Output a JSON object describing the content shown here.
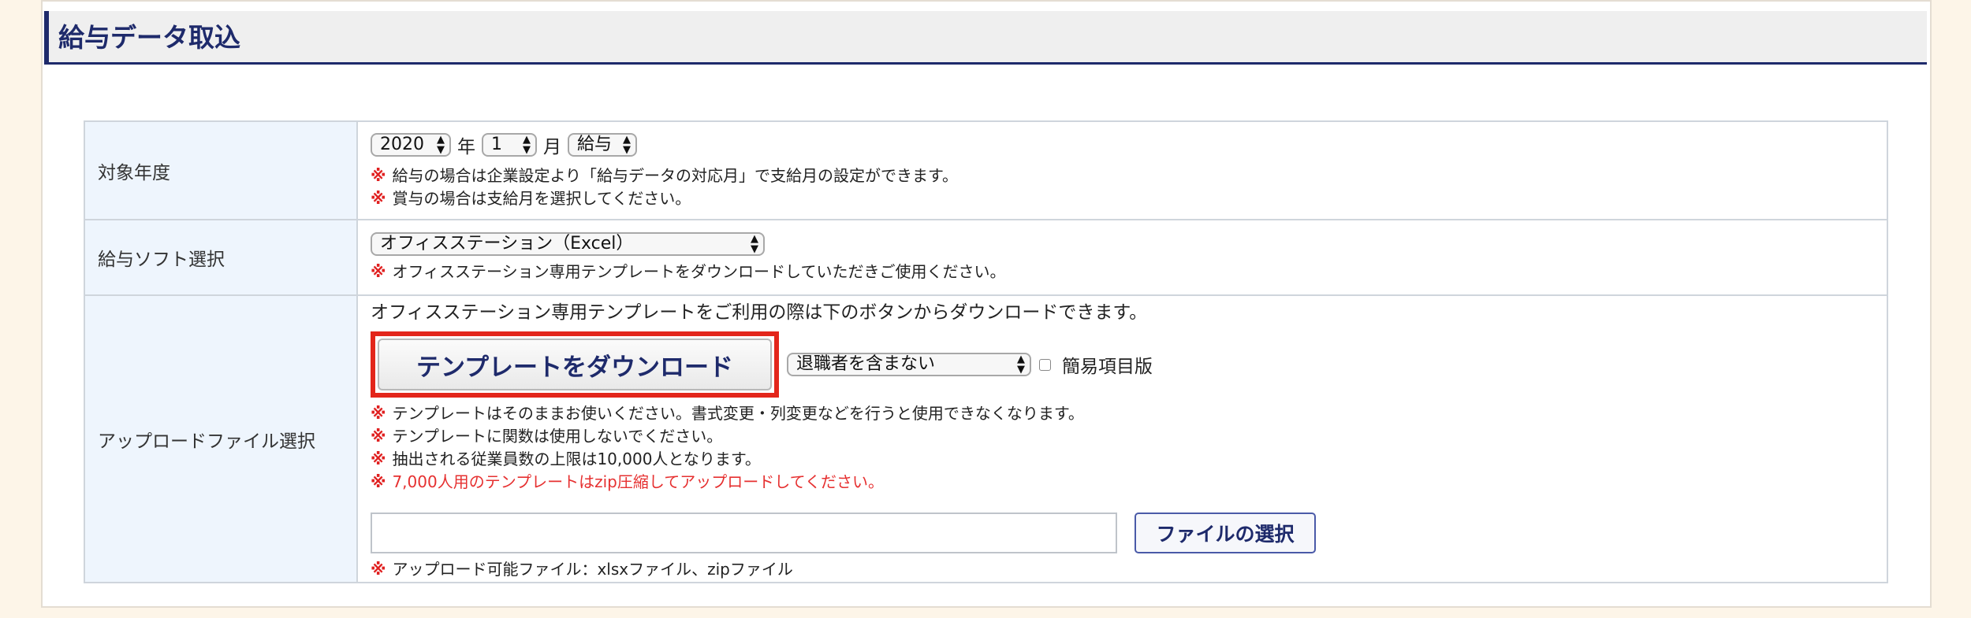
{
  "page": {
    "title": "給与データ取込"
  },
  "form": {
    "target_year": {
      "label": "対象年度",
      "year_value": "2020",
      "year_unit": "年",
      "month_value": "1",
      "month_unit": "月",
      "type_value": "給与",
      "notes": [
        "給与の場合は企業設定より「給与データの対応月」で支給月の設定ができます。",
        "賞与の場合は支給月を選択してください。"
      ]
    },
    "software": {
      "label": "給与ソフト選択",
      "selected": "オフィスステーション（Excel）",
      "note": "オフィスステーション専用テンプレートをダウンロードしていただきご使用ください。"
    },
    "upload": {
      "label": "アップロードファイル選択",
      "intro": "オフィスステーション専用テンプレートをご利用の際は下のボタンからダウンロードできます。",
      "download_button": "テンプレートをダウンロード",
      "retire_option": "退職者を含まない",
      "simple_checkbox_label": "簡易項目版",
      "notes": [
        "テンプレートはそのままお使いください。書式変更・列変更などを行うと使用できなくなります。",
        "テンプレートに関数は使用しないでください。",
        "抽出される従業員数の上限は10,000人となります。"
      ],
      "red_note": "7,000人用のテンプレートはzip圧縮してアップロードしてください。",
      "file_button": "ファイルの選択",
      "file_note": "アップロード可能ファイル：xlsxファイル、zipファイル"
    },
    "note_mark": "※"
  },
  "colors": {
    "accent": "#1e2a6b",
    "highlight": "#e3261b",
    "note_red": "#e63030"
  }
}
